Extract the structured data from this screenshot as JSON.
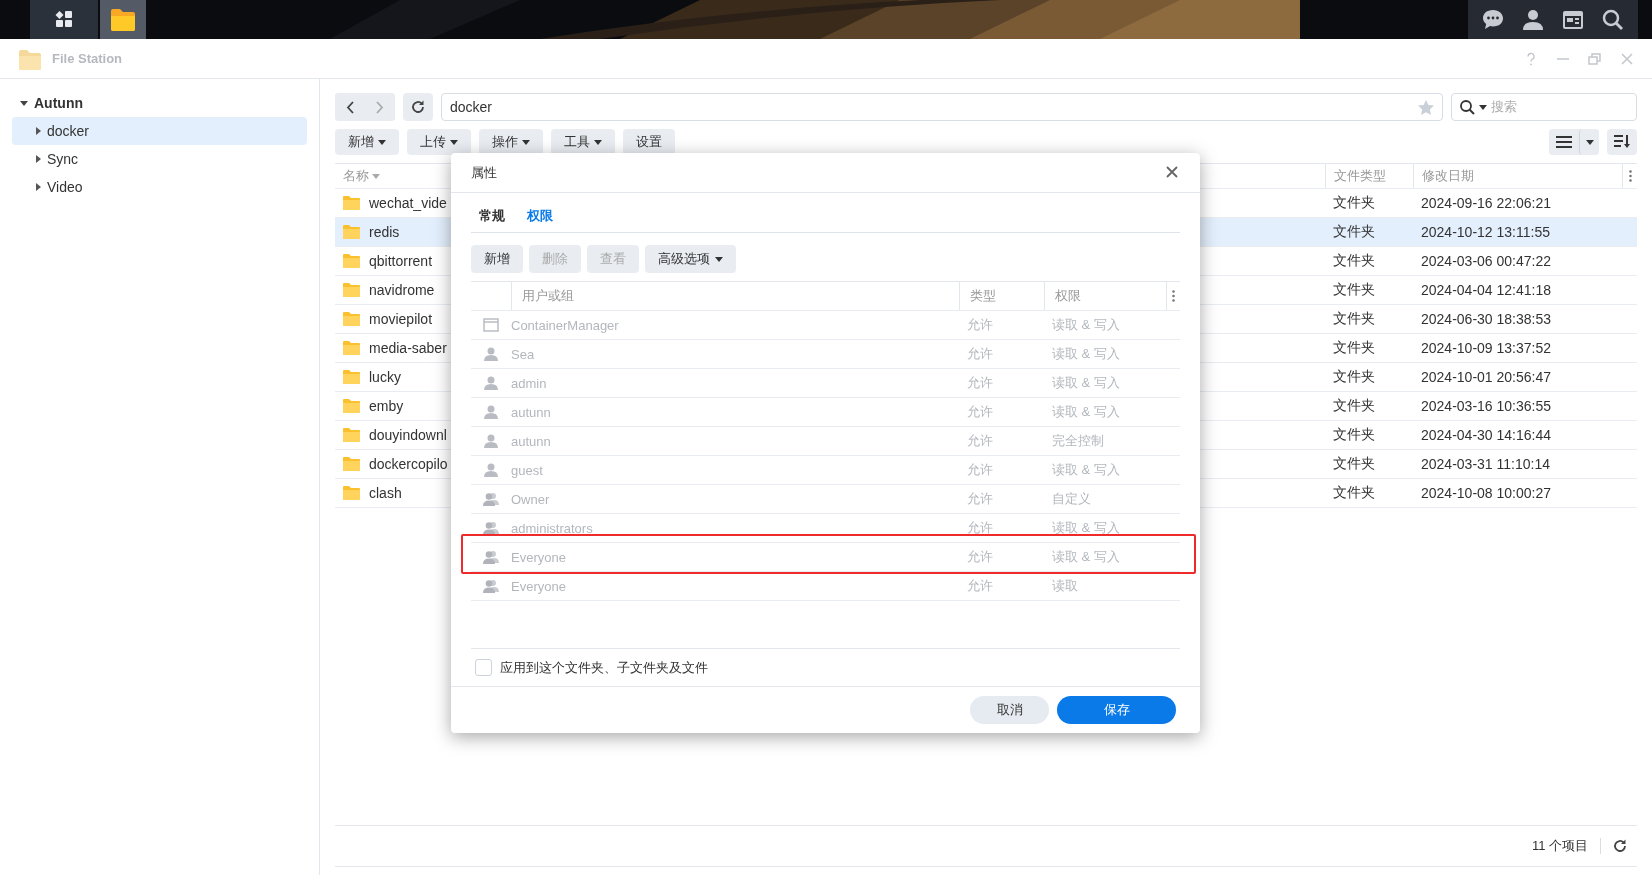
{
  "taskbar": {
    "apps": [
      {
        "selected": false
      },
      {
        "selected": true
      }
    ]
  },
  "window": {
    "title": "File Station"
  },
  "sidebar": {
    "root": {
      "label": "Autunn",
      "expanded": true,
      "children": [
        {
          "label": "docker",
          "selected": true,
          "expanded": false
        },
        {
          "label": "Sync",
          "selected": false,
          "expanded": false
        },
        {
          "label": "Video",
          "selected": false,
          "expanded": false
        }
      ]
    }
  },
  "nav": {
    "path": "docker",
    "search_placeholder": "搜索"
  },
  "toolbar": [
    {
      "label": "新增",
      "dropdown": true
    },
    {
      "label": "上传",
      "dropdown": true
    },
    {
      "label": "操作",
      "dropdown": true
    },
    {
      "label": "工具",
      "dropdown": true
    },
    {
      "label": "设置",
      "dropdown": false
    }
  ],
  "file_table": {
    "columns": [
      {
        "label": "名称",
        "sorted": true
      },
      {
        "label": "文件类型",
        "sorted": false
      },
      {
        "label": "修改日期",
        "sorted": false
      }
    ],
    "rows": [
      {
        "name": "wechat_vide",
        "type": "文件夹",
        "modified": "2024-09-16 22:06:21",
        "selected": false
      },
      {
        "name": "redis",
        "type": "文件夹",
        "modified": "2024-10-12 13:11:55",
        "selected": true
      },
      {
        "name": "qbittorrent",
        "type": "文件夹",
        "modified": "2024-03-06 00:47:22",
        "selected": false
      },
      {
        "name": "navidrome",
        "type": "文件夹",
        "modified": "2024-04-04 12:41:18",
        "selected": false
      },
      {
        "name": "moviepilot",
        "type": "文件夹",
        "modified": "2024-06-30 18:38:53",
        "selected": false
      },
      {
        "name": "media-saber",
        "type": "文件夹",
        "modified": "2024-10-09 13:37:52",
        "selected": false
      },
      {
        "name": "lucky",
        "type": "文件夹",
        "modified": "2024-10-01 20:56:47",
        "selected": false
      },
      {
        "name": "emby",
        "type": "文件夹",
        "modified": "2024-03-16 10:36:55",
        "selected": false
      },
      {
        "name": "douyindownl",
        "type": "文件夹",
        "modified": "2024-04-30 14:16:44",
        "selected": false
      },
      {
        "name": "dockercopilo",
        "type": "文件夹",
        "modified": "2024-03-31 11:10:14",
        "selected": false
      },
      {
        "name": "clash",
        "type": "文件夹",
        "modified": "2024-10-08 10:00:27",
        "selected": false
      }
    ]
  },
  "status_bar": {
    "count": "11 个项目"
  },
  "dialog": {
    "title": "属性",
    "tabs": [
      {
        "label": "常规",
        "selected": false
      },
      {
        "label": "权限",
        "selected": true
      }
    ],
    "buttons": [
      {
        "label": "新增",
        "disabled": false,
        "dropdown": false
      },
      {
        "label": "删除",
        "disabled": true,
        "dropdown": false
      },
      {
        "label": "查看",
        "disabled": true,
        "dropdown": false
      },
      {
        "label": "高级选项",
        "disabled": false,
        "dropdown": true
      }
    ],
    "columns": [
      "用户或组",
      "类型",
      "权限"
    ],
    "rows": [
      {
        "kind": "app",
        "name": "ContainerManager",
        "type": "允许",
        "permission": "读取 & 写入",
        "disabled": true,
        "highlighted": false
      },
      {
        "kind": "user",
        "name": "Sea",
        "type": "允许",
        "permission": "读取 & 写入",
        "disabled": true,
        "highlighted": false
      },
      {
        "kind": "user",
        "name": "admin",
        "type": "允许",
        "permission": "读取 & 写入",
        "disabled": true,
        "highlighted": false
      },
      {
        "kind": "user",
        "name": "autunn",
        "type": "允许",
        "permission": "读取 & 写入",
        "disabled": true,
        "highlighted": false
      },
      {
        "kind": "user",
        "name": "autunn",
        "type": "允许",
        "permission": "完全控制",
        "disabled": true,
        "highlighted": false
      },
      {
        "kind": "user",
        "name": "guest",
        "type": "允许",
        "permission": "读取 & 写入",
        "disabled": true,
        "highlighted": false
      },
      {
        "kind": "group",
        "name": "Owner",
        "type": "允许",
        "permission": "自定义",
        "disabled": true,
        "highlighted": false
      },
      {
        "kind": "group",
        "name": "administrators",
        "type": "允许",
        "permission": "读取 & 写入",
        "disabled": true,
        "highlighted": false
      },
      {
        "kind": "group",
        "name": "Everyone",
        "type": "允许",
        "permission": "读取 & 写入",
        "disabled": true,
        "highlighted": true
      },
      {
        "kind": "group",
        "name": "Everyone",
        "type": "允许",
        "permission": "读取",
        "disabled": true,
        "highlighted": false
      }
    ],
    "apply": {
      "label": "应用到这个文件夹、子文件夹及文件",
      "checked": false
    },
    "actions": [
      {
        "label": "取消",
        "primary": false
      },
      {
        "label": "保存",
        "primary": true
      }
    ]
  }
}
